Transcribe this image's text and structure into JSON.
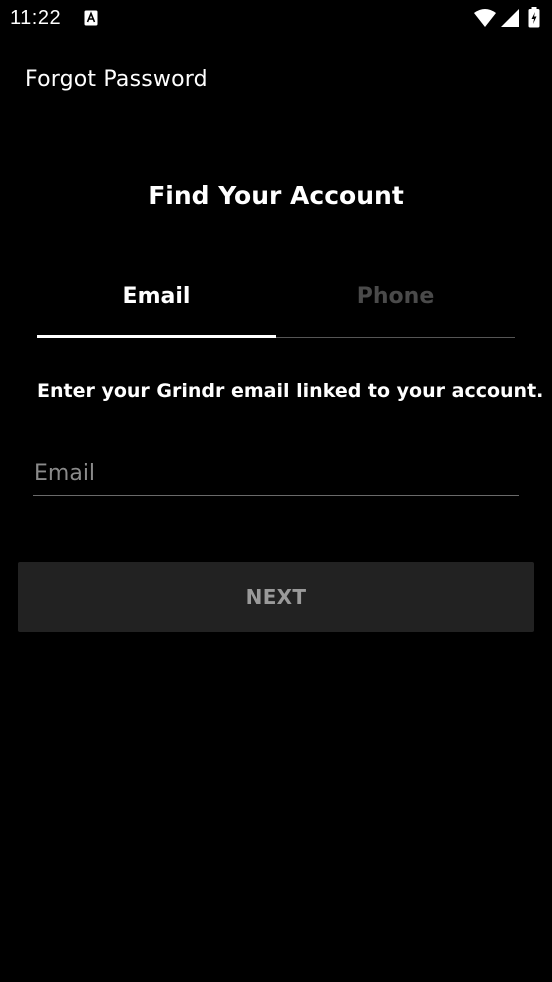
{
  "status_bar": {
    "time": "11:22",
    "icons": [
      "notification-a-icon",
      "wifi-icon",
      "signal-icon",
      "battery-charging-icon"
    ]
  },
  "toolbar": {
    "title": "Forgot Password"
  },
  "main": {
    "heading": "Find Your Account",
    "tabs": [
      {
        "label": "Email",
        "selected": true
      },
      {
        "label": "Phone",
        "selected": false
      }
    ],
    "instructions": "Enter your Grindr email linked to your account.",
    "email_field": {
      "placeholder": "Email",
      "value": ""
    },
    "next_button": {
      "label": "NEXT",
      "enabled": false
    }
  },
  "colors": {
    "background": "#000000",
    "text": "#ffffff",
    "inactive_tab": "#4a4a4a",
    "button_bg": "#222222",
    "button_text": "#9a9a9a"
  }
}
